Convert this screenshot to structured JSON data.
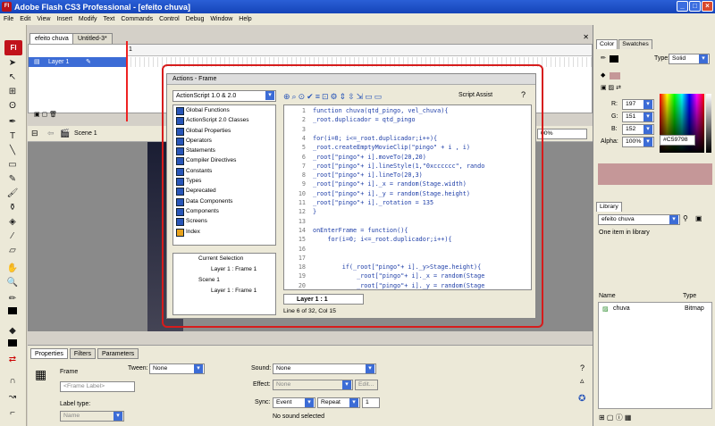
{
  "window": {
    "title": "Adobe Flash CS3 Professional - [efeito chuva]",
    "app_icon": "Fl"
  },
  "menu": [
    "File",
    "Edit",
    "View",
    "Insert",
    "Modify",
    "Text",
    "Commands",
    "Control",
    "Debug",
    "Window",
    "Help"
  ],
  "doc_tabs": [
    "efeito chuva",
    "Untitled-3*"
  ],
  "timeline": {
    "layer_name": "Layer 1",
    "frame_number": "1"
  },
  "edit_bar": {
    "scene": "Scene 1",
    "zoom": "00%"
  },
  "actions_panel": {
    "title": "Actions - Frame",
    "version_select": "ActionScript 1.0 & 2.0",
    "script_assist": "Script Assist",
    "categories": [
      "Global Functions",
      "ActionScript 2.0 Classes",
      "Global Properties",
      "Operators",
      "Statements",
      "Compiler Directives",
      "Constants",
      "Types",
      "Deprecated",
      "Data Components",
      "Components",
      "Screens",
      "Index"
    ],
    "scope": [
      {
        "label": "Current Selection",
        "indent": 0
      },
      {
        "label": "Layer 1 : Frame 1",
        "indent": 1
      },
      {
        "label": "Scene 1",
        "indent": 0
      },
      {
        "label": "Layer 1 : Frame 1",
        "indent": 1
      }
    ],
    "code_lines": [
      {
        "n": "1",
        "t": "function chuva(qtd_pingo, vel_chuva){"
      },
      {
        "n": "2",
        "t": "_root.duplicador = qtd_pingo"
      },
      {
        "n": "3",
        "t": ""
      },
      {
        "n": "4",
        "t": "for(i=0; i<=_root.duplicador;i++){"
      },
      {
        "n": "5",
        "t": "_root.createEmptyMovieClip(\"pingo\" + i , i)"
      },
      {
        "n": "6",
        "t": "_root[\"pingo\"+ i].moveTo(20,20)"
      },
      {
        "n": "7",
        "t": "_root[\"pingo\"+ i].lineStyle(1,\"0xcccccc\", rando"
      },
      {
        "n": "8",
        "t": "_root[\"pingo\"+ i].lineTo(20,3)"
      },
      {
        "n": "9",
        "t": "_root[\"pingo\"+ i]._x = random(Stage.width)"
      },
      {
        "n": "10",
        "t": "_root[\"pingo\"+ i]._y = random(Stage.height)"
      },
      {
        "n": "11",
        "t": "_root[\"pingo\"+ i]._rotation = 135"
      },
      {
        "n": "12",
        "t": "}"
      },
      {
        "n": "13",
        "t": ""
      },
      {
        "n": "14",
        "t": "onEnterFrame = function(){"
      },
      {
        "n": "15",
        "t": "    for(i=0; i<=_root.duplicador;i++){"
      },
      {
        "n": "16",
        "t": ""
      },
      {
        "n": "17",
        "t": ""
      },
      {
        "n": "18",
        "t": "        if(_root[\"pingo\"+ i]._y>Stage.height){"
      },
      {
        "n": "19",
        "t": "            _root[\"pingo\"+ i]._x = random(Stage"
      },
      {
        "n": "20",
        "t": "            _root[\"pingo\"+ i]._y = random(Stage"
      }
    ],
    "code_tab": "Layer 1 : 1",
    "status": "Line 6 of 32, Col 15"
  },
  "properties": {
    "tabs": [
      "Properties",
      "Filters",
      "Parameters"
    ],
    "frame_label": "Frame",
    "frame_input_placeholder": "<Frame Label>",
    "label_type_label": "Label type:",
    "label_type_value": "Name",
    "tween_label": "Tween:",
    "tween_value": "None",
    "sound_label": "Sound:",
    "sound_value": "None",
    "effect_label": "Effect:",
    "effect_value": "None",
    "edit_button": "Edit...",
    "sync_label": "Sync:",
    "sync_value": "Event",
    "repeat_value": "Repeat",
    "repeat_count": "1",
    "no_sound": "No sound selected"
  },
  "color_panel": {
    "tabs": [
      "Color",
      "Swatches"
    ],
    "type_label": "Type:",
    "type_value": "Solid",
    "r_label": "R:",
    "r": "197",
    "g_label": "G:",
    "g": "151",
    "b_label": "B:",
    "b": "152",
    "alpha_label": "Alpha:",
    "alpha": "100%",
    "hex": "#C59798",
    "swatch_color": "#C59798"
  },
  "library_panel": {
    "tab": "Library",
    "doc": "efeito chuva",
    "count": "One item in library",
    "col_name": "Name",
    "col_type": "Type",
    "items": [
      {
        "name": "chuva",
        "type": "Bitmap"
      }
    ]
  }
}
